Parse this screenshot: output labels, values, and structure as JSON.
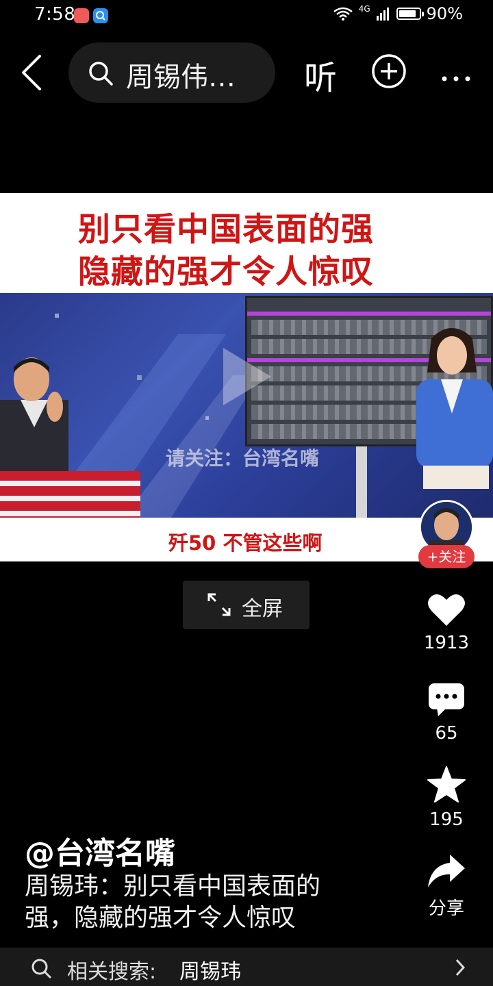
{
  "status_bar": {
    "time": "7:58",
    "network": "4G",
    "battery": "90%"
  },
  "top_nav": {
    "search_text": "周锡伟…",
    "listen_label": "听"
  },
  "video": {
    "title_line1": "别只看中国表面的强",
    "title_line2": "隐藏的强才令人惊叹",
    "watermark": "请关注：台湾名嘴",
    "subtitle": "歼50 不管这些啊",
    "fullscreen_label": "全屏"
  },
  "follow_label": "+关注",
  "actions": {
    "like_count": "1913",
    "comment_count": "65",
    "favorite_count": "195",
    "share_label": "分享"
  },
  "post": {
    "author": "@台湾名嘴",
    "description": "周锡玮：别只看中国表面的强，隐藏的强才令人惊叹"
  },
  "related": {
    "label": "相关搜索:",
    "term": "周锡玮"
  },
  "colors": {
    "accent_red": "#d11414",
    "follow_red": "#e23a3f"
  }
}
